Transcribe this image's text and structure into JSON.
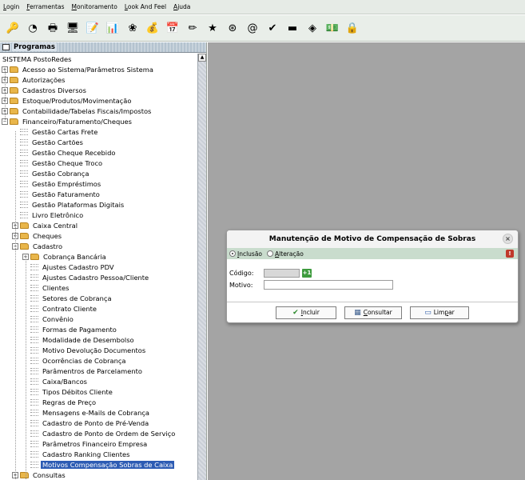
{
  "menubar": {
    "items": [
      {
        "label": "Login",
        "mnemonic": "L",
        "rest": "ogin"
      },
      {
        "label": "Ferramentas",
        "mnemonic": "F",
        "rest": "erramentas"
      },
      {
        "label": "Monitoramento",
        "mnemonic": "M",
        "rest": "onitoramento"
      },
      {
        "label": "Look And Feel",
        "mnemonic": "L",
        "rest": "ook And Feel"
      },
      {
        "label": "Ajuda",
        "mnemonic": "A",
        "rest": "juda"
      }
    ]
  },
  "toolbar": {
    "icons": [
      {
        "name": "user-key-icon",
        "glyph": "🔑"
      },
      {
        "name": "clock-icon",
        "glyph": "◔"
      },
      {
        "name": "printer-icon",
        "glyph": "🖶"
      },
      {
        "name": "computers-icon",
        "glyph": "🖥"
      },
      {
        "name": "note-icon",
        "glyph": "📝"
      },
      {
        "name": "chart-icon",
        "glyph": "📊"
      },
      {
        "name": "flower-icon",
        "glyph": "❀"
      },
      {
        "name": "money-icon",
        "glyph": "💰"
      },
      {
        "name": "calendar-icon",
        "glyph": "📅"
      },
      {
        "name": "pen-icon",
        "glyph": "✏"
      },
      {
        "name": "star-icon",
        "glyph": "★"
      },
      {
        "name": "steering-wheel-icon",
        "glyph": "⊛"
      },
      {
        "name": "at-sign-icon",
        "glyph": "@"
      },
      {
        "name": "check-mark-icon",
        "glyph": "✔"
      },
      {
        "name": "card-icon",
        "glyph": "▬"
      },
      {
        "name": "flag-icon",
        "glyph": "◈"
      },
      {
        "name": "cash-icon",
        "glyph": "💵"
      },
      {
        "name": "lock-icon",
        "glyph": "🔒"
      }
    ]
  },
  "left_panel": {
    "title": "Programas",
    "root": "SISTEMA PostoRedes",
    "tree": [
      {
        "level": 0,
        "type": "folder",
        "toggle": "+",
        "label": "Acesso ao Sistema/Parâmetros Sistema"
      },
      {
        "level": 0,
        "type": "folder",
        "toggle": "+",
        "label": "Autorizações"
      },
      {
        "level": 0,
        "type": "folder",
        "toggle": "+",
        "label": "Cadastros Diversos"
      },
      {
        "level": 0,
        "type": "folder",
        "toggle": "+",
        "label": "Estoque/Produtos/Movimentação"
      },
      {
        "level": 0,
        "type": "folder",
        "toggle": "+",
        "label": "Contabilidade/Tabelas Fiscais/Impostos"
      },
      {
        "level": 0,
        "type": "folder",
        "toggle": "-",
        "label": "Financeiro/Faturamento/Cheques"
      },
      {
        "level": 1,
        "type": "leaf",
        "label": "Gestão Cartas Frete"
      },
      {
        "level": 1,
        "type": "leaf",
        "label": "Gestão Cartões"
      },
      {
        "level": 1,
        "type": "leaf",
        "label": "Gestão Cheque Recebido"
      },
      {
        "level": 1,
        "type": "leaf",
        "label": "Gestão Cheque Troco"
      },
      {
        "level": 1,
        "type": "leaf",
        "label": "Gestão Cobrança"
      },
      {
        "level": 1,
        "type": "leaf",
        "label": "Gestão Empréstimos"
      },
      {
        "level": 1,
        "type": "leaf",
        "label": "Gestão Faturamento"
      },
      {
        "level": 1,
        "type": "leaf",
        "label": "Gestão Plataformas Digitais"
      },
      {
        "level": 1,
        "type": "leaf",
        "label": "Livro Eletrônico"
      },
      {
        "level": 1,
        "type": "folder",
        "toggle": "+",
        "label": "Caixa Central"
      },
      {
        "level": 1,
        "type": "folder",
        "toggle": "+",
        "label": "Cheques"
      },
      {
        "level": 1,
        "type": "folder",
        "toggle": "-",
        "label": "Cadastro"
      },
      {
        "level": 2,
        "type": "folder",
        "toggle": "+",
        "label": "Cobrança Bancária"
      },
      {
        "level": 2,
        "type": "leaf",
        "label": "Ajustes Cadastro PDV"
      },
      {
        "level": 2,
        "type": "leaf",
        "label": "Ajustes Cadastro Pessoa/Cliente"
      },
      {
        "level": 2,
        "type": "leaf",
        "label": "Clientes"
      },
      {
        "level": 2,
        "type": "leaf",
        "label": "Setores de Cobrança"
      },
      {
        "level": 2,
        "type": "leaf",
        "label": "Contrato Cliente"
      },
      {
        "level": 2,
        "type": "leaf",
        "label": "Convênio"
      },
      {
        "level": 2,
        "type": "leaf",
        "label": "Formas de Pagamento"
      },
      {
        "level": 2,
        "type": "leaf",
        "label": "Modalidade de Desembolso"
      },
      {
        "level": 2,
        "type": "leaf",
        "label": "Motivo Devolução Documentos"
      },
      {
        "level": 2,
        "type": "leaf",
        "label": "Ocorrências de Cobrança"
      },
      {
        "level": 2,
        "type": "leaf",
        "label": "Parâmentros de Parcelamento"
      },
      {
        "level": 2,
        "type": "leaf",
        "label": "Caixa/Bancos"
      },
      {
        "level": 2,
        "type": "leaf",
        "label": "Tipos Débitos Cliente"
      },
      {
        "level": 2,
        "type": "leaf",
        "label": "Regras de Preço"
      },
      {
        "level": 2,
        "type": "leaf",
        "label": "Mensagens e-Mails de Cobrança"
      },
      {
        "level": 2,
        "type": "leaf",
        "label": "Cadastro de Ponto de Pré-Venda"
      },
      {
        "level": 2,
        "type": "leaf",
        "label": "Cadastro de Ponto de Ordem de Serviço"
      },
      {
        "level": 2,
        "type": "leaf",
        "label": "Parâmetros Financeiro Empresa"
      },
      {
        "level": 2,
        "type": "leaf",
        "label": "Cadastro Ranking Clientes"
      },
      {
        "level": 2,
        "type": "leaf",
        "label": "Motivos Compensação Sobras de Caixa",
        "selected": true
      },
      {
        "level": 1,
        "type": "folder",
        "toggle": "+",
        "label": "Consultas"
      }
    ]
  },
  "dialog": {
    "title": "Manutenção de Motivo de Compensação de Sobras",
    "close_glyph": "×",
    "mode_options": [
      {
        "mnemonic": "I",
        "rest": "nclusão",
        "checked": true
      },
      {
        "mnemonic": "A",
        "rest": "lteração",
        "checked": false
      }
    ],
    "help_glyph": "!",
    "codigo_label": "Código:",
    "codigo_value": "",
    "codigo_add_glyph": "+1",
    "motivo_label": "Motivo:",
    "motivo_value": "",
    "buttons": {
      "incluir": {
        "mnemonic": "I",
        "rest": "ncluir",
        "icon": "✔"
      },
      "consultar": {
        "mnemonic": "C",
        "rest": "onsultar",
        "icon": "▦"
      },
      "limpar": {
        "pre": "Lim",
        "mnemonic": "p",
        "rest": "ar",
        "icon": "▭"
      }
    }
  },
  "colors": {
    "desktop": "#a4a4a4",
    "selection": "#2d5cb4",
    "radio_bar": "#c9dccd"
  }
}
